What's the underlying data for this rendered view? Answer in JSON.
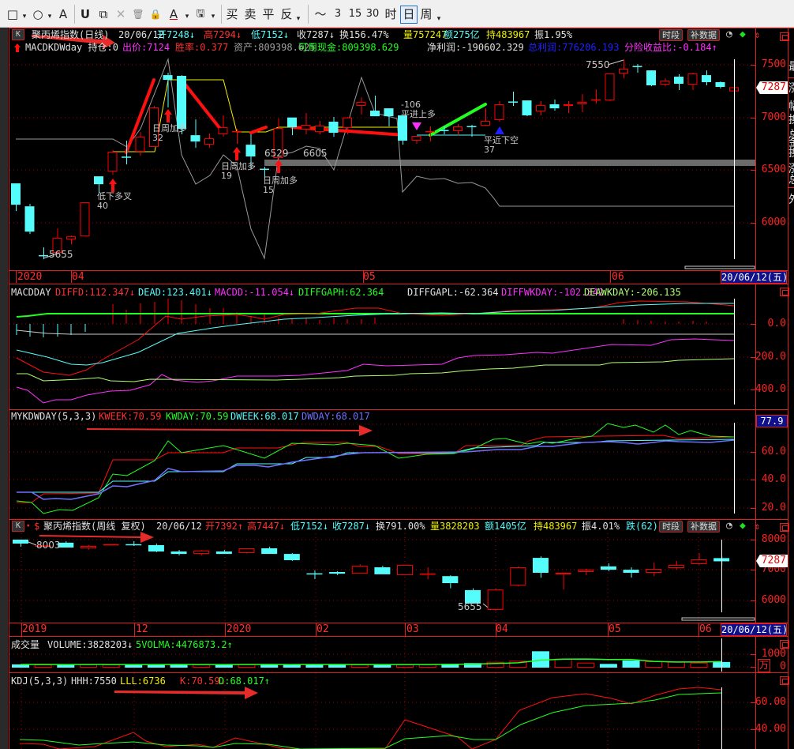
{
  "toolbar": {
    "items": [
      "□",
      "▾",
      "○",
      "▾",
      "A",
      "U",
      "⧉",
      "✕",
      "🗑",
      "🔒",
      "A",
      "▾",
      "🖫",
      "▾",
      "买",
      "卖",
      "平",
      "反",
      "▾",
      "〜",
      "3",
      "15",
      "30",
      "时",
      "日",
      "周",
      "▾"
    ]
  },
  "daily": {
    "k_label": "K",
    "title": "聚丙烯指数(日线)",
    "date": "20/06/12",
    "open": "开7248↓",
    "high": "高7294↓",
    "low": "低7152↓",
    "close": "收7287↓",
    "turnover": "换156.47%",
    "volume": "量757247",
    "amount": "额275亿",
    "hold": "持483967",
    "amplitude": "振1.95%",
    "btn_period": "时段",
    "btn_fill": "补数据",
    "strategy": {
      "arrow": "↑",
      "name": "MACDKDWday 持仓:0",
      "bid": "出价:7124",
      "winrate": "胜率:0.377",
      "assets": "资产:809398.625",
      "cash": "可用现金:809398.629",
      "net_profit": "净利润:-190602.329",
      "total_profit": "总利润:776206.193",
      "risk_ratio": "分险收益比:-0.184↑"
    },
    "axis": [
      "7500",
      "7000",
      "6500",
      "6000"
    ],
    "price_tag": "7287",
    "dates": [
      "2020",
      "04",
      "05",
      "06"
    ],
    "cursor_date": "20/06/12(五)",
    "annotations": {
      "low": "5655",
      "high": "7550",
      "l1": "6529",
      "l2": "6605",
      "s1": "低下多叉",
      "n1": "40",
      "s2": "日周加多",
      "n2": "32",
      "s3": "日周加多",
      "n3": "19",
      "s4": "日周加多",
      "n4": "15",
      "s5": "-106",
      "s6": "平进上多",
      "s7": "平近下空",
      "n7": "37"
    },
    "candles": [
      [
        6375,
        6375,
        6112,
        6172
      ],
      [
        6157,
        6180,
        5895,
        5917
      ],
      [
        5692,
        5767,
        5655,
        5685
      ],
      [
        5715,
        5947,
        5700,
        5857
      ],
      [
        5842,
        5880,
        5797,
        5872
      ],
      [
        5872,
        6195,
        5872,
        6195
      ],
      [
        6442,
        6442,
        6277,
        6367
      ],
      [
        6487,
        6690,
        6457,
        6675
      ],
      [
        6627,
        6780,
        6555,
        6620
      ],
      [
        6675,
        6862,
        6637,
        6817
      ],
      [
        6720,
        7110,
        6720,
        7095
      ],
      [
        7402,
        7425,
        7095,
        7357
      ],
      [
        7395,
        7402,
        6840,
        6892
      ],
      [
        6832,
        6982,
        6712,
        6772
      ],
      [
        6742,
        6847,
        6712,
        6802
      ],
      [
        6840,
        7020,
        6817,
        6907
      ],
      [
        6862,
        6892,
        6750,
        6870
      ],
      [
        6742,
        6840,
        6510,
        6630
      ],
      [
        6512,
        6532,
        6420,
        6505
      ],
      [
        6615,
        6990,
        6600,
        6900
      ],
      [
        7000,
        7000,
        6832,
        6907
      ],
      [
        6885,
        7042,
        6840,
        6930
      ],
      [
        6862,
        6967,
        6840,
        6922
      ],
      [
        6960,
        7005,
        6817,
        6855
      ],
      [
        6900,
        7005,
        6840,
        7000
      ],
      [
        7110,
        7192,
        7027,
        7147
      ],
      [
        7065,
        7207,
        7012,
        7012
      ],
      [
        7087,
        7087,
        6915,
        7012
      ],
      [
        7020,
        7020,
        6742,
        6780
      ],
      [
        6780,
        6825,
        6750,
        6825
      ],
      [
        6862,
        6915,
        6772,
        6870
      ],
      [
        6880,
        6915,
        6840,
        6875
      ],
      [
        6870,
        6937,
        6832,
        6915
      ],
      [
        6917,
        6930,
        6817,
        6910
      ],
      [
        6922,
        7087,
        6922,
        6967
      ],
      [
        6975,
        7155,
        6960,
        7125
      ],
      [
        7150,
        7245,
        7110,
        7145
      ],
      [
        7162,
        7162,
        7012,
        7020
      ],
      [
        7057,
        7155,
        7020,
        7117
      ],
      [
        7125,
        7170,
        7065,
        7087
      ],
      [
        7110,
        7155,
        7042,
        7125
      ],
      [
        7125,
        7222,
        7050,
        7147
      ],
      [
        7165,
        7267,
        7132,
        7170
      ],
      [
        7162,
        7417,
        7155,
        7417
      ],
      [
        7417,
        7550,
        7372,
        7462
      ],
      [
        7487,
        7507,
        7425,
        7480
      ],
      [
        7447,
        7447,
        7297,
        7305
      ],
      [
        7312,
        7372,
        7297,
        7350
      ],
      [
        7387,
        7410,
        7260,
        7320
      ],
      [
        7312,
        7425,
        7260,
        7417
      ],
      [
        7402,
        7447,
        7305,
        7335
      ],
      [
        7335,
        7342,
        7275,
        7290
      ],
      [
        7248,
        7294,
        7152,
        7287
      ]
    ]
  },
  "macd": {
    "name": "MACDDAY",
    "diffd": "DIFFD:112.347↓",
    "dead": "DEAD:123.401↓",
    "macdd": "MACDD:-11.054↓",
    "diffgaph": "DIFFGAPH:62.364",
    "diffgapl": "DIFFGAPL:-62.364",
    "diffwkday": "DIFFWKDAY:-102.342",
    "deawkday": "DEAWKDAY:-206.135",
    "axis": [
      "0.0",
      "200.0",
      "400.0"
    ]
  },
  "kdw": {
    "name": "MYKDWDAY(5,3,3)",
    "kweek": "KWEEK:70.59",
    "kwday": "KWDAY:70.59",
    "dweek": "DWEEK:68.017",
    "dwday": "DWDAY:68.017",
    "axis": [
      "60.0",
      "40.0",
      "20.0"
    ],
    "value_tag": "77.9"
  },
  "weekly": {
    "k_label": "K",
    "title": "聚丙烯指数(周线 复权)",
    "date": "20/06/12",
    "open": "开7392↑",
    "high": "高7447↓",
    "low": "低7152↓",
    "close": "收7287↓",
    "turnover": "换791.00%",
    "volume": "量3828203",
    "amount": "额1405亿",
    "hold": "持483967",
    "amplitude": "振4.01%",
    "fall": "跌(62)",
    "btn_period": "时段",
    "btn_fill": "补数据",
    "axis": [
      "8000",
      "7000",
      "6000"
    ],
    "price_tag": "7287",
    "dates": [
      "2019",
      "12",
      "2020",
      "02",
      "03",
      "04",
      "05",
      "06"
    ],
    "cursor_date": "20/06/12(五)",
    "high_label": "8003",
    "low_label": "5655",
    "candles": [
      [
        8000,
        8003,
        7770,
        7870
      ],
      [
        7780,
        7830,
        7760,
        7800
      ],
      [
        7900,
        7950,
        7740,
        7740
      ],
      [
        7710,
        7820,
        7670,
        7790
      ],
      [
        7815,
        7850,
        7810,
        7840
      ],
      [
        7845,
        7950,
        7790,
        7835
      ],
      [
        7820,
        7870,
        7590,
        7610
      ],
      [
        7610,
        7660,
        7480,
        7530
      ],
      [
        7530,
        7660,
        7480,
        7640
      ],
      [
        7610,
        7660,
        7530,
        7530
      ],
      [
        7560,
        7715,
        7540,
        7715
      ],
      [
        7715,
        7770,
        7530,
        7530
      ],
      [
        7530,
        7560,
        7300,
        7325
      ],
      [
        6885,
        6990,
        6700,
        6875
      ],
      [
        6935,
        6960,
        6830,
        6880
      ],
      [
        6880,
        7190,
        6880,
        7140
      ],
      [
        7090,
        7140,
        6860,
        6860
      ],
      [
        6830,
        7170,
        6830,
        7170
      ],
      [
        6870,
        7090,
        6700,
        6880
      ],
      [
        6800,
        6830,
        6400,
        6570
      ],
      [
        6340,
        6400,
        5900,
        5900
      ],
      [
        5690,
        6400,
        5655,
        6360
      ],
      [
        6490,
        7120,
        6460,
        7090
      ],
      [
        7400,
        7450,
        6750,
        6910
      ],
      [
        6860,
        6910,
        6360,
        6910
      ],
      [
        6935,
        7040,
        6830,
        7010
      ],
      [
        7120,
        7220,
        6960,
        7010
      ],
      [
        7010,
        7090,
        6750,
        6910
      ],
      [
        6910,
        7250,
        6800,
        7040
      ],
      [
        7065,
        7300,
        7010,
        7170
      ],
      [
        7195,
        7550,
        7170,
        7350
      ],
      [
        7392,
        7447,
        7152,
        7287
      ]
    ]
  },
  "volume": {
    "name": "成交量",
    "volume": "VOLUME:3828203↓",
    "ma": "5VOLMA:4476873.2↑",
    "axis": [
      "1000",
      "0"
    ],
    "unit": "万",
    "values": [
      190,
      180,
      170,
      200,
      180,
      175,
      185,
      195,
      180,
      170,
      200,
      185,
      180,
      190,
      170,
      175,
      185,
      180,
      200,
      230,
      295,
      395,
      480,
      1230,
      645,
      330,
      230,
      500,
      440,
      395,
      330,
      383
    ]
  },
  "kdj": {
    "name": "KDJ(5,3,3)",
    "hhh": "HHH:7550",
    "lll": "LLL:6736",
    "k": "K:70.59↓",
    "d": "D:68.017↑",
    "axis": [
      "60.00",
      "40.00"
    ]
  },
  "side_panel": [
    "最",
    "涨",
    "幅",
    "换",
    "总",
    "金",
    "换",
    "涨",
    "总",
    "外"
  ],
  "colors": {
    "up": "#ff0000",
    "down": "#54fcfc",
    "grid": "#a00000",
    "axis": "#e02020"
  }
}
